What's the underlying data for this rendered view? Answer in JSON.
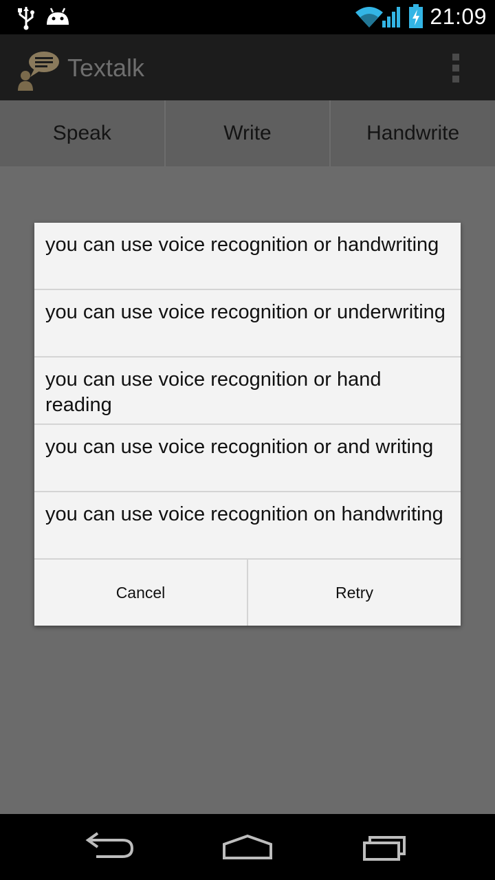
{
  "status_bar": {
    "time": "21:09",
    "icons": [
      "usb-icon",
      "android-icon",
      "wifi-icon",
      "signal-icon",
      "battery-charging-icon"
    ],
    "accent_color": "#33b5e5"
  },
  "action_bar": {
    "app_title": "Textalk",
    "app_icon": "speech-bubble-person-icon",
    "overflow_icon": "overflow-menu-icon"
  },
  "tabs": [
    {
      "label": "Speak"
    },
    {
      "label": "Write"
    },
    {
      "label": "Handwrite"
    }
  ],
  "dialog": {
    "items": [
      {
        "text": "you can use voice recognition or handwriting"
      },
      {
        "text": "you can use voice recognition or underwriting"
      },
      {
        "text": "you can use voice recognition or hand reading"
      },
      {
        "text": "you can use voice recognition or and writing"
      },
      {
        "text": "you can use voice recognition on handwriting"
      }
    ],
    "cancel_label": "Cancel",
    "retry_label": "Retry"
  },
  "nav_bar": {
    "icons": [
      "back-icon",
      "home-icon",
      "recent-apps-icon"
    ]
  }
}
